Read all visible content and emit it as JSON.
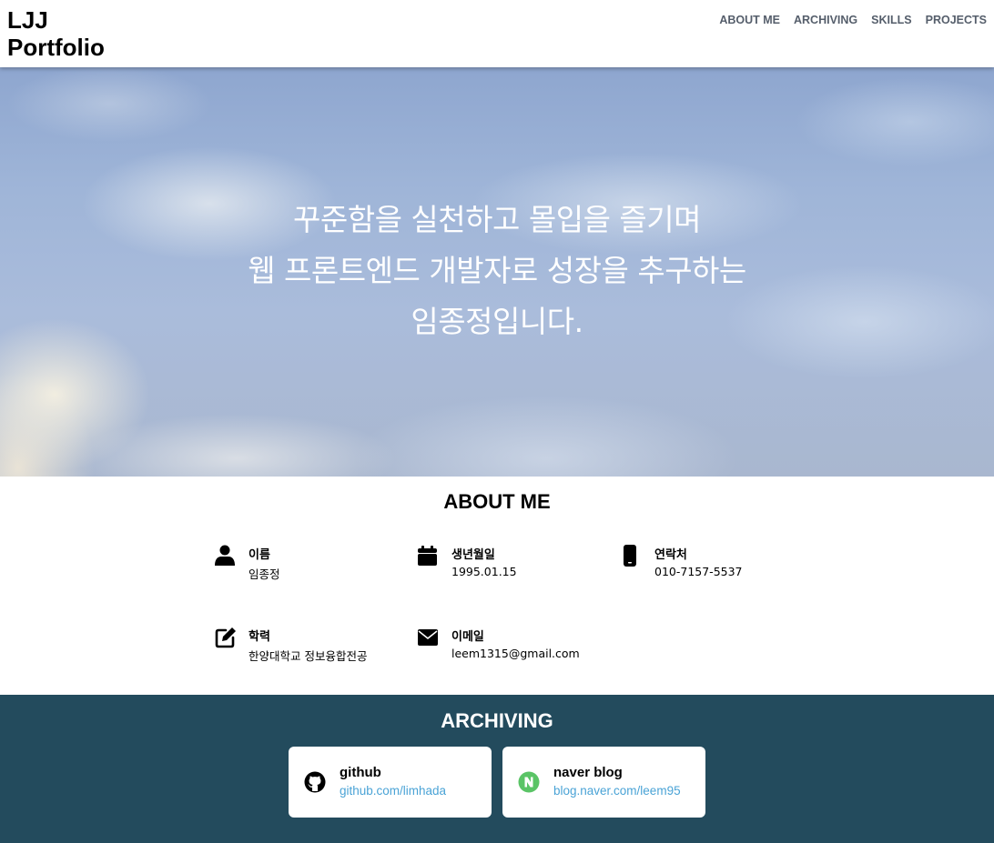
{
  "header": {
    "logo_line1": "LJJ",
    "logo_line2": "Portfolio",
    "nav": [
      "ABOUT ME",
      "ARCHIVING",
      "SKILLS",
      "PROJECTS"
    ]
  },
  "hero": {
    "lines": [
      "꾸준함을 실천하고 몰입을 즐기며",
      "웹 프론트엔드 개발자로 성장을 추구하는",
      "임종정입니다."
    ]
  },
  "about": {
    "title": "ABOUT ME",
    "items": [
      {
        "icon": "user-icon",
        "label": "이름",
        "value": "임종정"
      },
      {
        "icon": "calendar-icon",
        "label": "생년월일",
        "value": "1995.01.15"
      },
      {
        "icon": "phone-icon",
        "label": "연락처",
        "value": "010-7157-5537"
      },
      {
        "icon": "edit-icon",
        "label": "학력",
        "value": "한양대학교 정보융합전공"
      },
      {
        "icon": "envelope-icon",
        "label": "이메일",
        "value": "leem1315@gmail.com"
      }
    ]
  },
  "archiving": {
    "title": "ARCHIVING",
    "cards": [
      {
        "icon": "github-icon",
        "title": "github",
        "link": "github.com/limhada"
      },
      {
        "icon": "naver-icon",
        "title": "naver blog",
        "link": "blog.naver.com/leem95"
      }
    ]
  },
  "colors": {
    "archiving_bg": "#234b5d",
    "link": "#4aa3d6",
    "nav": "#555e6b",
    "naver_green": "#5ac466"
  }
}
